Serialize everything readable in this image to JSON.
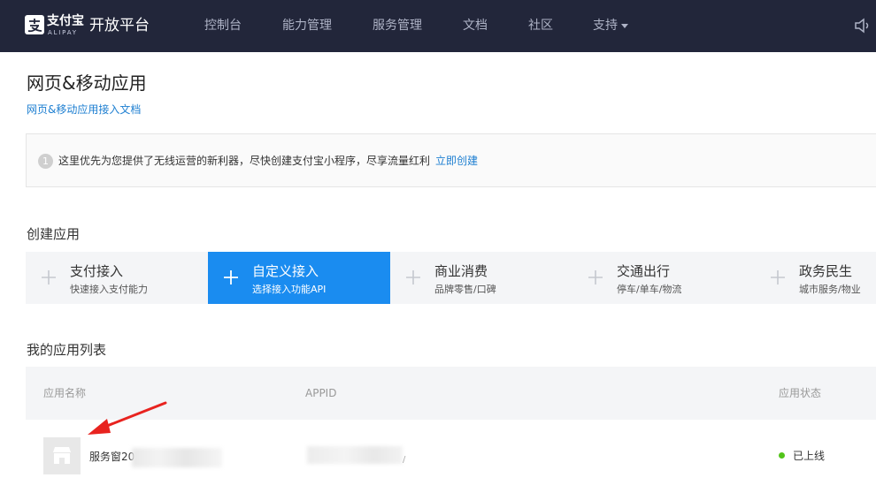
{
  "header": {
    "logo_cn": "支付宝",
    "logo_en": "ALIPAY",
    "platform_title": "开放平台",
    "nav": [
      "控制台",
      "能力管理",
      "服务管理",
      "文档",
      "社区",
      "支持"
    ]
  },
  "page": {
    "title": "网页&移动应用",
    "doc_link": "网页&移动应用接入文档"
  },
  "notice": {
    "number": "1",
    "text": "这里优先为您提供了无线运营的新利器，尽快创建支付宝小程序，尽享流量红利",
    "link": "立即创建"
  },
  "create": {
    "section_title": "创建应用",
    "cards": [
      {
        "title": "支付接入",
        "sub": "快速接入支付能力",
        "active": false
      },
      {
        "title": "自定义接入",
        "sub": "选择接入功能API",
        "active": true
      },
      {
        "title": "商业消费",
        "sub": "品牌零售/口碑",
        "active": false
      },
      {
        "title": "交通出行",
        "sub": "停车/单车/物流",
        "active": false
      },
      {
        "title": "政务民生",
        "sub": "城市服务/物业",
        "active": false
      }
    ]
  },
  "apps": {
    "section_title": "我的应用列表",
    "columns": [
      "应用名称",
      "APPID",
      "应用状态"
    ],
    "rows": [
      {
        "name": "服务窗20",
        "status": "已上线",
        "status_color": "#52c41a"
      }
    ]
  },
  "colors": {
    "topbar": "#22263a",
    "accent": "#1a8cf0",
    "link": "#1e7fd1",
    "annotation_arrow": "#e8231f"
  }
}
